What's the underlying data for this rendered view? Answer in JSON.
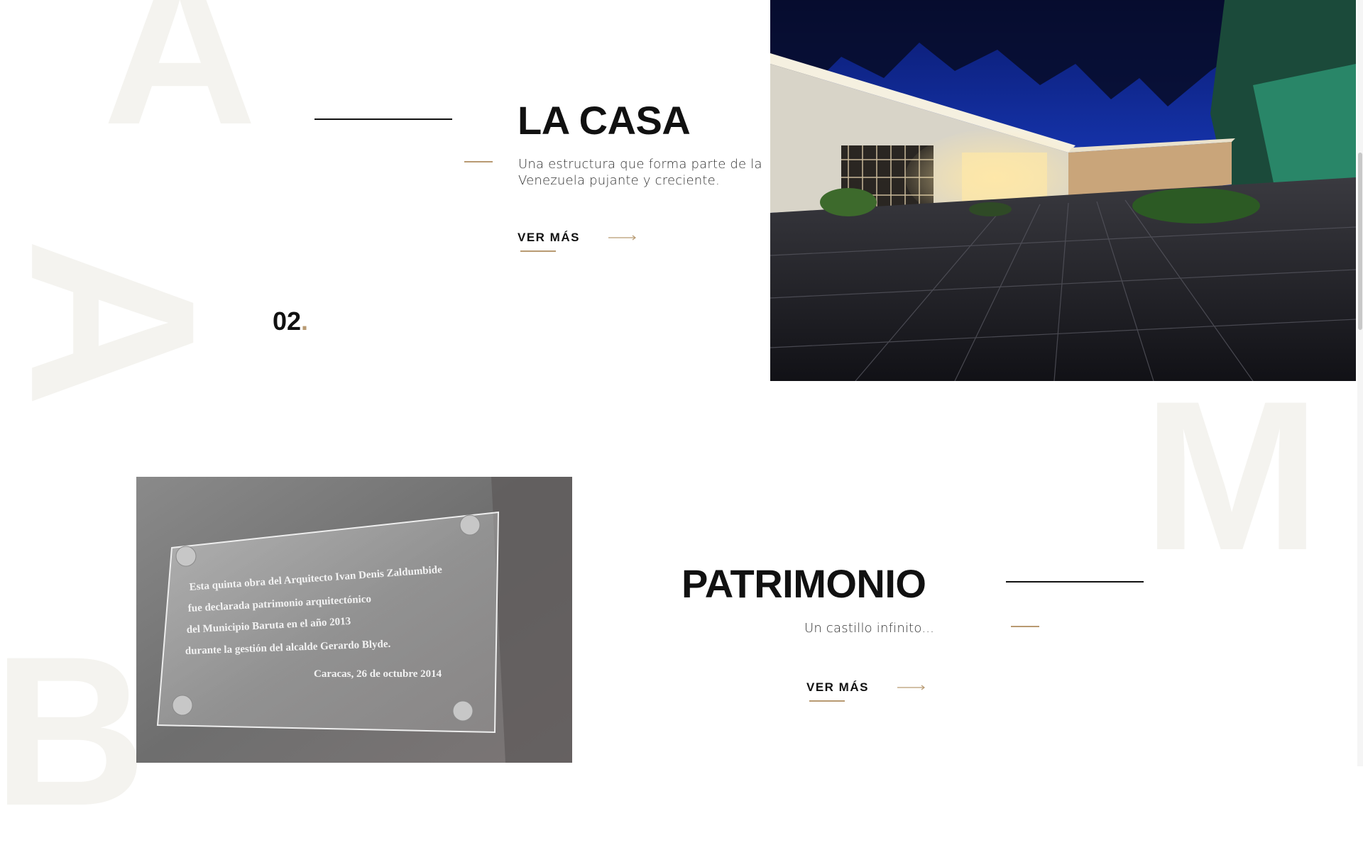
{
  "background_letters": [
    "A",
    "A",
    "M",
    "B"
  ],
  "sections": [
    {
      "title": "LA CASA",
      "description_line1": "Una estructura que forma parte de la",
      "description_line2": "Venezuela pujante y creciente.",
      "cta": "VER MÁS",
      "number": "02",
      "number_dot": ".",
      "image": "night-house-courtyard-photo"
    },
    {
      "title": "PATRIMONIO",
      "description": "Un castillo infinito...",
      "cta": "VER MÁS",
      "image": "glass-plaque-photo",
      "plaque": {
        "line1": "Esta quinta obra del Arquitecto Ivan Denis Zaldumbide",
        "line2": "fue declarada patrimonio arquitectónico",
        "line3": "del Municipio Baruta en el año 2013",
        "line4": "durante la gestión del alcalde Gerardo Blyde.",
        "date": "Caracas, 26 de octubre 2014"
      }
    }
  ],
  "colors": {
    "accent": "#b89a72",
    "text": "#111111",
    "watermark": "#f4f3ef"
  },
  "icons": [
    "arrow-right-icon"
  ]
}
